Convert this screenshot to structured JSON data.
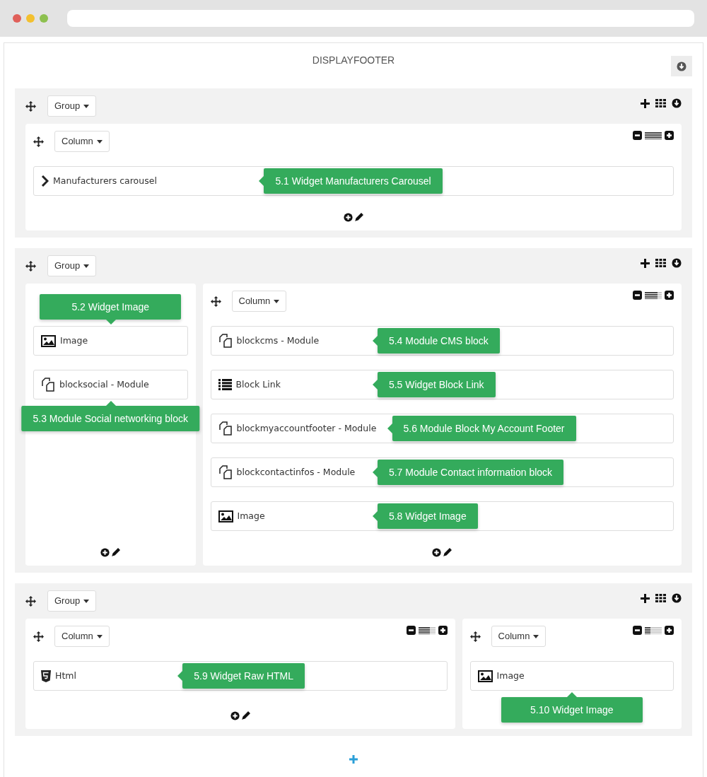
{
  "title": "DISPLAYFOOTER",
  "groups": [
    {
      "label": "Group",
      "columns": [
        {
          "label": "Column",
          "level": 1,
          "footer": true,
          "items": [
            {
              "kind": "chevron",
              "text": "Manufacturers carousel",
              "tooltip": {
                "text": "5.1 Widget Manufacturers Carousel",
                "kind": "leftward"
              }
            }
          ]
        }
      ]
    },
    {
      "label": "Group",
      "columns": [
        {
          "footer": true,
          "items": [
            {
              "kind": "image",
              "text": "Image",
              "tooltip": {
                "text": "5.2 Widget Image",
                "kind": "downward"
              }
            },
            {
              "kind": "module",
              "text": "blocksocial - Module",
              "tooltip": {
                "text": "5.3 Module Social networking block",
                "kind": "upward"
              }
            }
          ]
        },
        {
          "label": "Column",
          "level": 0.75,
          "footer": true,
          "items": [
            {
              "kind": "module",
              "text": "blockcms - Module",
              "tooltip": {
                "text": "5.4 Module CMS block",
                "kind": "leftward"
              }
            },
            {
              "kind": "list",
              "text": "Block Link",
              "tooltip": {
                "text": "5.5 Widget Block Link",
                "kind": "leftward"
              }
            },
            {
              "kind": "module",
              "text": "blockmyaccountfooter - Module",
              "tooltip": {
                "text": "5.6 Module Block My Account Footer",
                "kind": "leftward"
              }
            },
            {
              "kind": "module",
              "text": "blockcontactinfos - Module",
              "tooltip": {
                "text": "5.7 Module Contact information block",
                "kind": "leftward"
              }
            },
            {
              "kind": "image",
              "text": "Image",
              "tooltip": {
                "text": "5.8 Widget Image",
                "kind": "leftward"
              }
            }
          ]
        }
      ]
    },
    {
      "label": "Group",
      "columns": [
        {
          "label": "Column",
          "level": 0.67,
          "footer": true,
          "items": [
            {
              "kind": "html",
              "text": "Html",
              "tooltip": {
                "text": "5.9 Widget Raw HTML",
                "kind": "leftward"
              }
            }
          ]
        },
        {
          "label": "Column",
          "level": 0.33,
          "footer": false,
          "items": [
            {
              "kind": "image",
              "text": "Image",
              "tooltip": {
                "text": "5.10 Widget Image",
                "kind": "upward"
              }
            }
          ]
        }
      ]
    }
  ]
}
